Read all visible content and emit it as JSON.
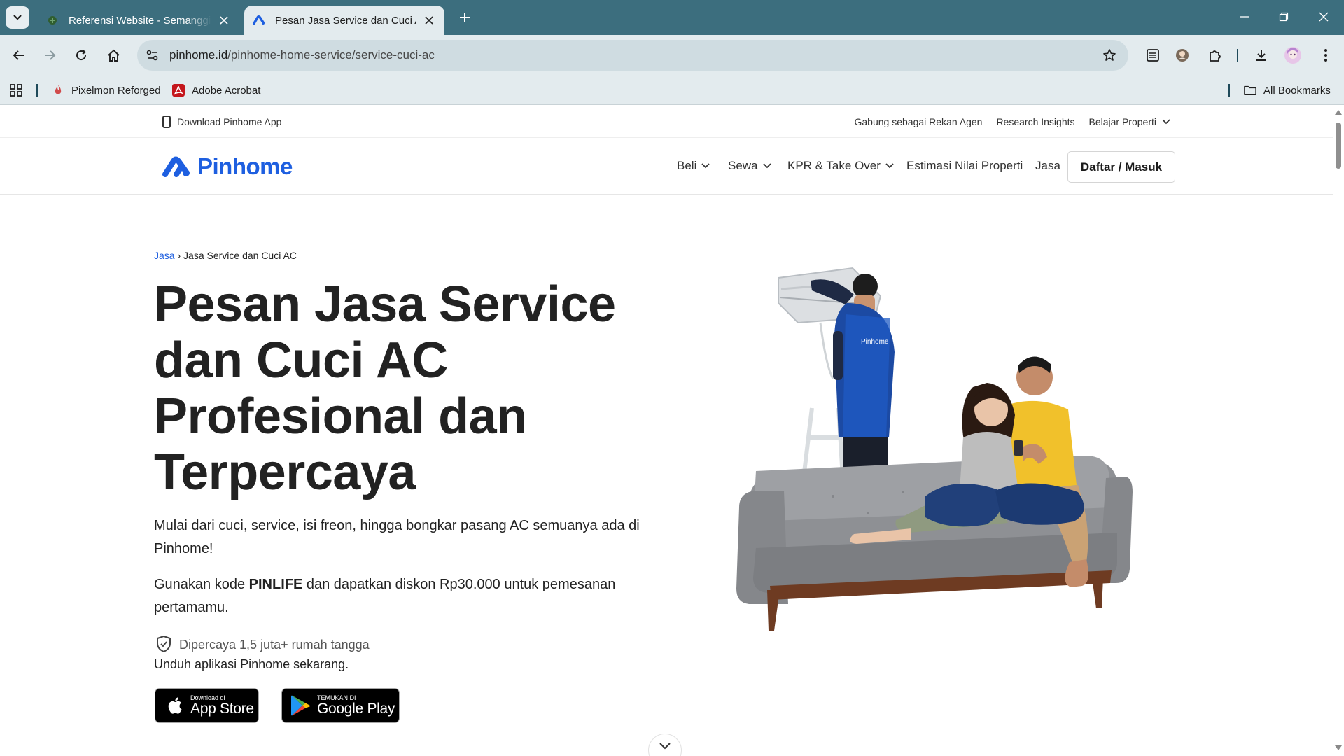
{
  "browser": {
    "tabs": [
      {
        "title": "Referensi Website - Semanggi Lestari",
        "active": false
      },
      {
        "title": "Pesan Jasa Service dan Cuci AC",
        "active": true
      }
    ],
    "url_host": "pinhome.id",
    "url_path": "/pinhome-home-service/service-cuci-ac",
    "bookmarks": [
      {
        "label": "Pixelmon Reforged"
      },
      {
        "label": "Adobe Acrobat"
      }
    ],
    "all_bookmarks_label": "All Bookmarks",
    "theme_color": "#3c6e7e"
  },
  "topbar": {
    "download_label": "Download Pinhome App",
    "links": [
      "Gabung sebagai Rekan Agen",
      "Research Insights",
      "Belajar Properti"
    ]
  },
  "nav": {
    "brand": "Pinhome",
    "brand_color": "#1e5fe0",
    "items": [
      "Beli",
      "Sewa",
      "KPR & Take Over",
      "Estimasi Nilai Properti",
      "Jasa"
    ],
    "login_label": "Daftar / Masuk"
  },
  "hero": {
    "breadcrumb_root": "Jasa",
    "breadcrumb_sep": "›",
    "breadcrumb_current": "Jasa Service dan Cuci AC",
    "title": "Pesan Jasa Service dan Cuci AC Profesional dan Terpercaya",
    "subtitle": "Mulai dari cuci, service, isi freon, hingga bongkar pasang AC semuanya ada di Pinhome!",
    "promo_prefix": "Gunakan kode ",
    "promo_code": "PINLIFE",
    "promo_suffix": " dan dapatkan diskon Rp30.000 untuk pemesanan pertamamu.",
    "trust_text": "Dipercaya 1,5 juta+ rumah tangga",
    "download_prompt": "Unduh aplikasi Pinhome sekarang.",
    "app_store": {
      "small": "Download di",
      "big": "App Store"
    },
    "google_play": {
      "small": "TEMUKAN DI",
      "big": "Google Play"
    },
    "illustration_badge": "Pinhome"
  }
}
